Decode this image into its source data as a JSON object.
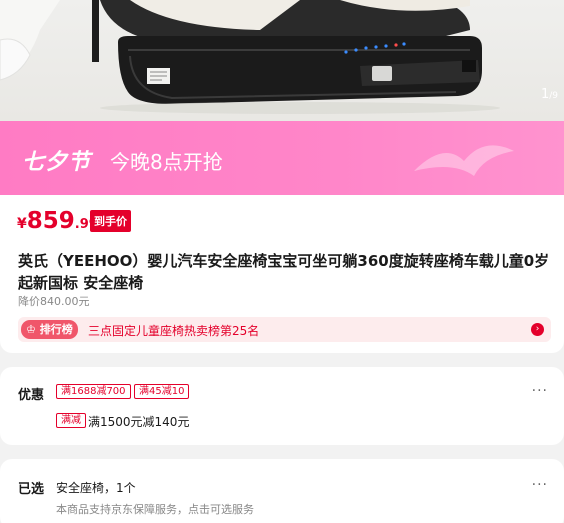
{
  "gallery": {
    "current": "1",
    "total": "/9"
  },
  "banner": {
    "festival": "七夕节",
    "tonight": "今晚8点开抢"
  },
  "product": {
    "price_symbol": "¥",
    "price_int": "859",
    "price_dec": ".99",
    "price_tag": "到手价",
    "title": "英氏（YEEHOO）婴儿汽车安全座椅宝宝可坐可躺360度旋转座椅车载儿童0岁起新国标 安全座椅",
    "original_price": "降价840.00元",
    "rank_badge": "排行榜",
    "rank_text": "三点固定儿童座椅热卖榜第25名"
  },
  "promotions": {
    "label": "优惠",
    "coupons": [
      "满1688减700",
      "满45减10"
    ],
    "promo_tag": "满减",
    "promo_text": "满1500元减140元"
  },
  "selection": {
    "label": "已选",
    "value": "安全座椅，1个",
    "service_note": "本商品支持京东保障服务，点击可选服务"
  },
  "colors": {
    "price_red": "#e4002b",
    "banner_pink": "#ff86c9"
  }
}
